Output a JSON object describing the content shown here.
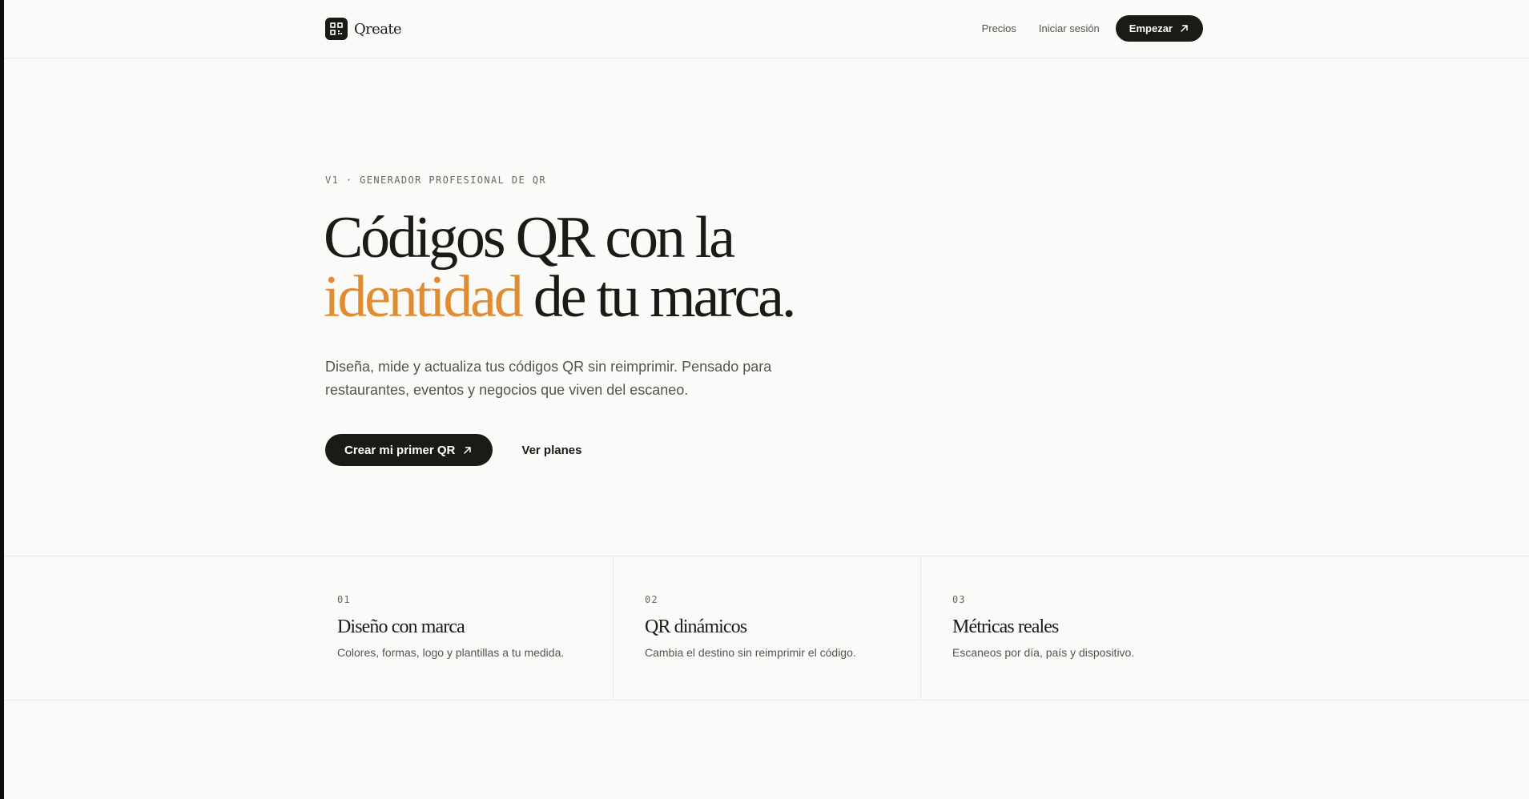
{
  "header": {
    "brand": "Qreate",
    "logo_icon": "qr-code-icon",
    "nav": {
      "pricing": "Precios",
      "login": "Iniciar sesión",
      "start": "Empezar",
      "start_icon": "arrow-up-right-icon"
    }
  },
  "hero": {
    "eyebrow": "V1 · GENERADOR PROFESIONAL DE QR",
    "title_line1": "Códigos QR con la",
    "title_accent": "identidad",
    "title_line2_rest": " de tu marca.",
    "description": "Diseña, mide y actualiza tus códigos QR sin reimprimir. Pensado para restaurantes, eventos y negocios que viven del escaneo.",
    "primary_cta": "Crear mi primer QR",
    "primary_cta_icon": "arrow-up-right-icon",
    "secondary_cta": "Ver planes"
  },
  "features": [
    {
      "num": "01",
      "title": "Diseño con marca",
      "desc": "Colores, formas, logo y plantillas a tu medida."
    },
    {
      "num": "02",
      "title": "QR dinámicos",
      "desc": "Cambia el destino sin reimprimir el código."
    },
    {
      "num": "03",
      "title": "Métricas reales",
      "desc": "Escaneos por día, país y dispositivo."
    }
  ],
  "colors": {
    "accent": "#df8c33",
    "dark": "#1c1a17",
    "background": "#fafaf9",
    "muted_text": "#57534e"
  }
}
